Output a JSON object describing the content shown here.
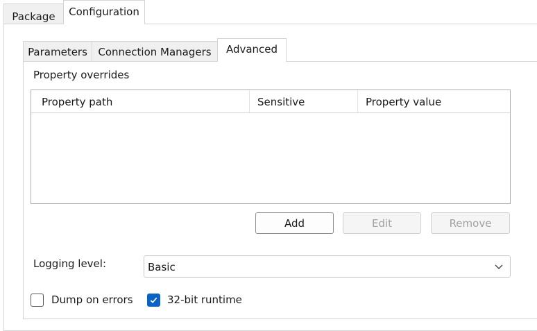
{
  "top_tabs": [
    {
      "label": "Package",
      "active": false
    },
    {
      "label": "Configuration",
      "active": true
    }
  ],
  "inner_tabs": [
    {
      "label": "Parameters",
      "active": false
    },
    {
      "label": "Connection Managers",
      "active": false
    },
    {
      "label": "Advanced",
      "active": true
    }
  ],
  "property_overrides": {
    "group_label": "Property overrides",
    "columns": [
      "Property path",
      "Sensitive",
      "Property value"
    ],
    "rows": []
  },
  "buttons": {
    "add": {
      "label": "Add",
      "enabled": true
    },
    "edit": {
      "label": "Edit",
      "enabled": false
    },
    "remove": {
      "label": "Remove",
      "enabled": false
    }
  },
  "logging": {
    "label": "Logging level:",
    "value": "Basic"
  },
  "options": {
    "dump_on_errors": {
      "label": "Dump on errors",
      "checked": false
    },
    "runtime_32bit": {
      "label": "32-bit runtime",
      "checked": true
    }
  },
  "colors": {
    "accent": "#0a62c4",
    "border": "#adadad"
  },
  "icons": {
    "dropdown": "chevron-down-icon",
    "checked": "checkmark-icon"
  }
}
